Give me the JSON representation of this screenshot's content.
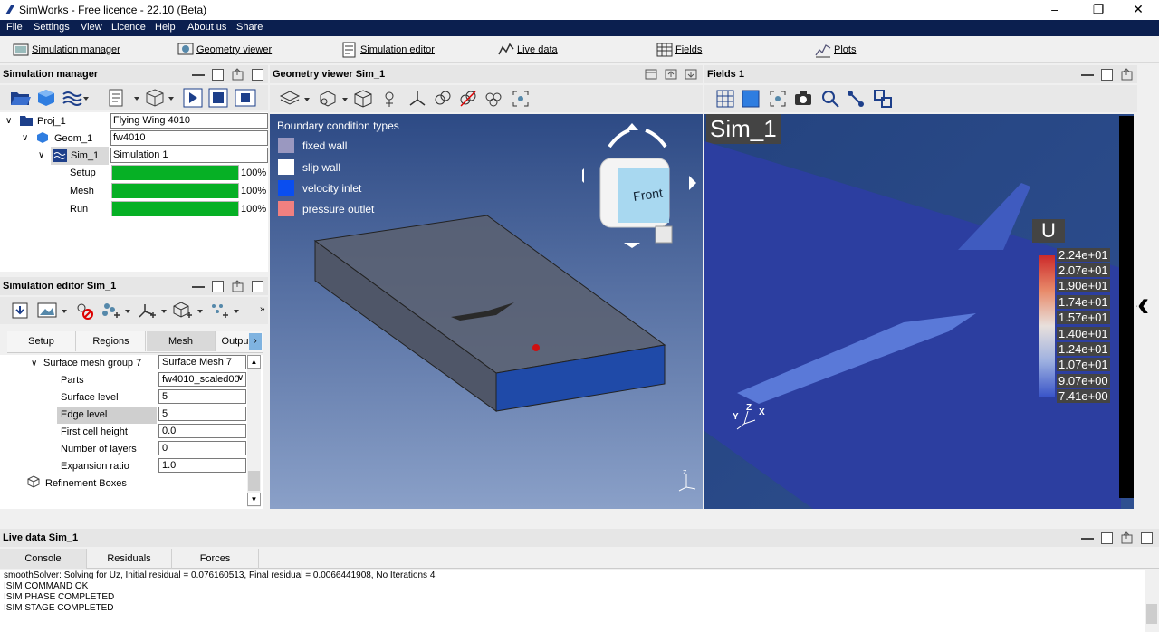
{
  "window": {
    "title": "SimWorks - Free licence - 22.10 (Beta)",
    "minimize": "–",
    "maximize": "❐",
    "close": "✕"
  },
  "menu": [
    "File",
    "Settings",
    "View",
    "Licence",
    "Help",
    "About us",
    "Share"
  ],
  "toolbar": {
    "simulation_manager": "Simulation manager",
    "geometry_viewer": "Geometry viewer",
    "simulation_editor": "Simulation editor",
    "live_data": "Live data",
    "fields": "Fields",
    "plots": "Plots"
  },
  "sim_manager": {
    "title": "Simulation manager",
    "tree": {
      "proj": {
        "label": "Proj_1",
        "value": "Flying Wing 4010"
      },
      "geom": {
        "label": "Geom_1",
        "value": "fw4010"
      },
      "sim": {
        "label": "Sim_1",
        "value": "Simulation 1"
      },
      "steps": [
        {
          "label": "Setup",
          "progress": 1.0,
          "percent": "100%"
        },
        {
          "label": "Mesh",
          "progress": 1.0,
          "percent": "100%"
        },
        {
          "label": "Run",
          "progress": 1.0,
          "percent": "100%"
        }
      ]
    }
  },
  "sim_editor": {
    "title": "Simulation editor Sim_1",
    "tabs": [
      "Setup",
      "Regions",
      "Mesh",
      "Outpu"
    ],
    "active_tab": "Mesh",
    "group_label": "Surface mesh group 7",
    "group_value": "Surface Mesh 7",
    "props": [
      {
        "label": "Parts",
        "value": "fw4010_scaled00"
      },
      {
        "label": "Surface level",
        "value": "5"
      },
      {
        "label": "Edge level",
        "value": "5"
      },
      {
        "label": "First cell height",
        "value": "0.0"
      },
      {
        "label": "Number of layers",
        "value": "0"
      },
      {
        "label": "Expansion ratio",
        "value": "1.0"
      }
    ],
    "refinement_boxes": "Refinement Boxes"
  },
  "geometry_viewer": {
    "title": "Geometry viewer Sim_1",
    "legend_title": "Boundary condition types",
    "legend": [
      {
        "label": "fixed wall",
        "color": "#9a98c0"
      },
      {
        "label": "slip wall",
        "color": "#ffffff"
      },
      {
        "label": "velocity inlet",
        "color": "#0a4ef0"
      },
      {
        "label": "pressure outlet",
        "color": "#f08080"
      }
    ],
    "cube_face": "Front"
  },
  "fields": {
    "title": "Fields 1",
    "sim_label": "Sim_1",
    "colorbar_title": "U",
    "colorbar_ticks": [
      "2.24e+01",
      "2.07e+01",
      "1.90e+01",
      "1.74e+01",
      "1.57e+01",
      "1.40e+01",
      "1.24e+01",
      "1.07e+01",
      "9.07e+00",
      "7.41e+00"
    ],
    "axes": {
      "x": "X",
      "y": "Y",
      "z": "Z"
    }
  },
  "live_data": {
    "title": "Live data Sim_1",
    "tabs": [
      "Console",
      "Residuals",
      "Forces"
    ],
    "active_tab": "Console",
    "lines": [
      "smoothSolver:  Solving for Uz, Initial residual = 0.076160513, Final residual = 0.0066441908, No Iterations 4",
      "ISIM COMMAND OK",
      "ISIM PHASE COMPLETED",
      "ISIM STAGE COMPLETED"
    ]
  },
  "colors": {
    "menubar": "#0b1f4f",
    "progress": "#06b025",
    "viewport_top": "#ffffff",
    "viewport_bottom": "#2d4a85"
  }
}
